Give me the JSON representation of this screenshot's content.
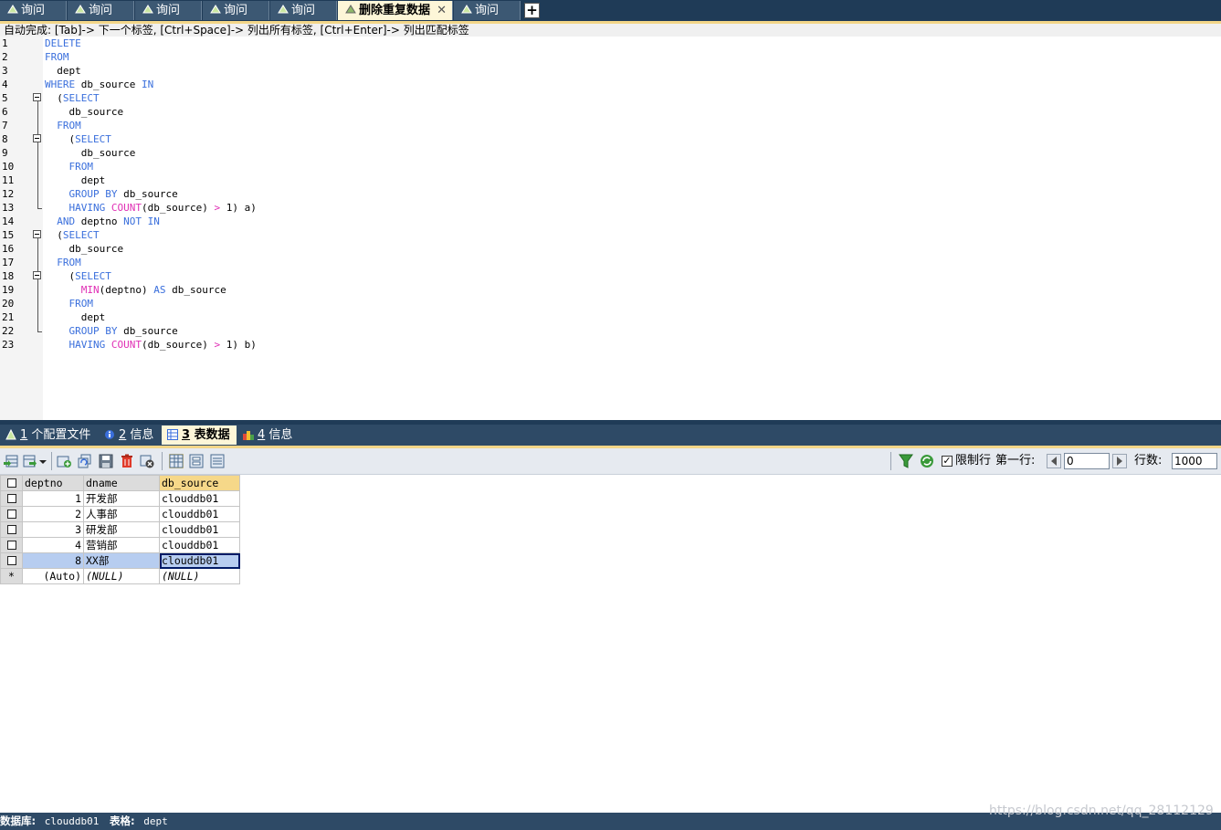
{
  "tabs": [
    {
      "label": "询问",
      "active": false
    },
    {
      "label": "询问",
      "active": false
    },
    {
      "label": "询问",
      "active": false
    },
    {
      "label": "询问",
      "active": false
    },
    {
      "label": "询问",
      "active": false
    },
    {
      "label": "删除重复数据",
      "active": true
    },
    {
      "label": "询问",
      "active": false
    }
  ],
  "close_glyph": "✕",
  "add_tab_glyph": "+",
  "autocomplete_hint": "自动完成: [Tab]-> 下一个标签, [Ctrl+Space]-> 列出所有标签, [Ctrl+Enter]-> 列出匹配标签",
  "editor": {
    "line_numbers": [
      "1",
      "2",
      "3",
      "4",
      "5",
      "6",
      "7",
      "8",
      "9",
      "10",
      "11",
      "12",
      "13",
      "14",
      "15",
      "16",
      "17",
      "18",
      "19",
      "20",
      "21",
      "22",
      "23"
    ]
  },
  "bottom_tabs": [
    {
      "num": "1",
      "label": " 个配置文件",
      "icon": "profile-icon"
    },
    {
      "num": "2",
      "label": " 信息",
      "icon": "info-icon"
    },
    {
      "num": "3",
      "label": " 表数据",
      "icon": "table-data-icon",
      "active": true
    },
    {
      "num": "4",
      "label": " 信息",
      "icon": "info-chart-icon"
    }
  ],
  "toolbar": {
    "limit_rows_checked": true,
    "limit_rows_label": "限制行",
    "first_row_label": "第一行:",
    "first_row_value": "0",
    "rows_label": "行数:",
    "rows_value": "1000"
  },
  "grid": {
    "columns": [
      "deptno",
      "dname",
      "db_source"
    ],
    "rows": [
      {
        "deptno": "1",
        "dname": "开发部",
        "db_source": "clouddb01"
      },
      {
        "deptno": "2",
        "dname": "人事部",
        "db_source": "clouddb01"
      },
      {
        "deptno": "3",
        "dname": "研发部",
        "db_source": "clouddb01"
      },
      {
        "deptno": "4",
        "dname": "营销部",
        "db_source": "clouddb01"
      },
      {
        "deptno": "8",
        "dname": "XX部",
        "db_source": "clouddb01"
      }
    ],
    "new_row": {
      "marker": "*",
      "deptno": "(Auto)",
      "dname": "(NULL)",
      "db_source": "(NULL)"
    }
  },
  "status": {
    "db_label": "数据库:",
    "db_value": "clouddb01",
    "table_label": "表格:",
    "table_value": "dept"
  },
  "watermark": "https://blog.csdn.net/qq_28112129",
  "colors": {
    "keyword": "#3a6fdc",
    "function": "#e02fb5",
    "tab_active": "#fdf6d8",
    "header_bar": "#1f3b57"
  }
}
